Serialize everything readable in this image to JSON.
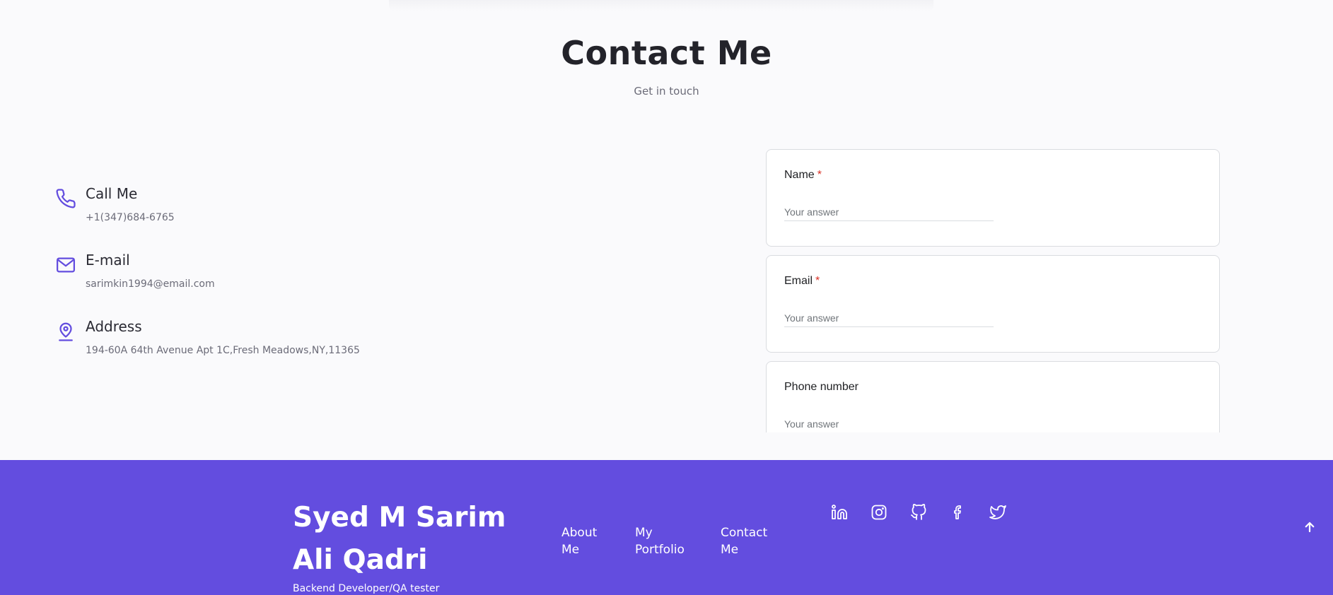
{
  "section": {
    "title": "Contact Me",
    "subtitle": "Get in touch"
  },
  "contact_info": [
    {
      "icon": "phone-icon",
      "label": "Call Me",
      "value": "+1(347)684-6765"
    },
    {
      "icon": "mail-icon",
      "label": "E-mail",
      "value": "sarimkin1994@email.com"
    },
    {
      "icon": "map-pin-icon",
      "label": "Address",
      "value": "194-60A 64th Avenue Apt 1C,Fresh Meadows,NY,11365"
    }
  ],
  "form": {
    "questions": [
      {
        "label": "Name",
        "required": "*",
        "placeholder": "Your answer"
      },
      {
        "label": "Email",
        "required": "*",
        "placeholder": "Your answer"
      },
      {
        "label": "Phone number",
        "required": "",
        "placeholder": "Your answer"
      }
    ]
  },
  "footer": {
    "name": "Syed M Sarim Ali Qadri",
    "role": "Backend Developer/QA tester",
    "links": [
      "About Me",
      "My Portfolio",
      "Contact Me"
    ],
    "social_icons": [
      "linkedin-icon",
      "instagram-icon",
      "github-icon",
      "facebook-icon",
      "twitter-icon"
    ],
    "scroll_top_icon": "arrow-up-icon"
  },
  "colors": {
    "accent": "#634ddf",
    "background": "#fafafc",
    "required": "#d93025"
  }
}
